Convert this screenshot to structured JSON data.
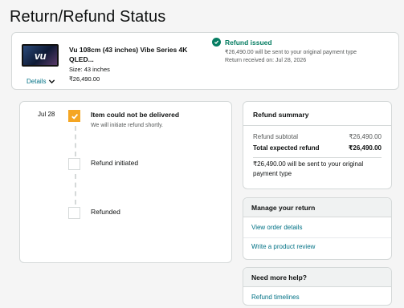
{
  "page": {
    "title": "Return/Refund Status"
  },
  "product": {
    "thumb_logo": "vu",
    "name": "Vu 108cm (43 inches) Vibe Series 4K QLED...",
    "size": "Size: 43 inches",
    "price": "₹26,490.00",
    "details_label": "Details",
    "refund_status": {
      "title": "Refund issued",
      "message": "₹26,490.00 will be sent to your original payment type",
      "received": "Return received on: Jul 28, 2026"
    }
  },
  "timeline": {
    "date": "Jul 28",
    "steps": [
      {
        "label": "Item could not be delivered",
        "sublabel": "We will initiate refund shortly.",
        "done": true
      },
      {
        "label": "Refund initiated",
        "done": false
      },
      {
        "label": "Refunded",
        "done": false
      }
    ]
  },
  "summary": {
    "title": "Refund summary",
    "subtotal_label": "Refund subtotal",
    "subtotal_value": "₹26,490.00",
    "total_label": "Total expected refund",
    "total_value": "₹26,490.00",
    "note": "₹26,490.00 will be sent to your original payment type"
  },
  "manage": {
    "title": "Manage your return",
    "links": [
      "View order details",
      "Write a product review"
    ]
  },
  "help": {
    "title": "Need more help?",
    "links": [
      "Refund timelines"
    ]
  },
  "colors": {
    "accent": "#007185",
    "success": "#067d62",
    "step_done": "#f5a623"
  }
}
